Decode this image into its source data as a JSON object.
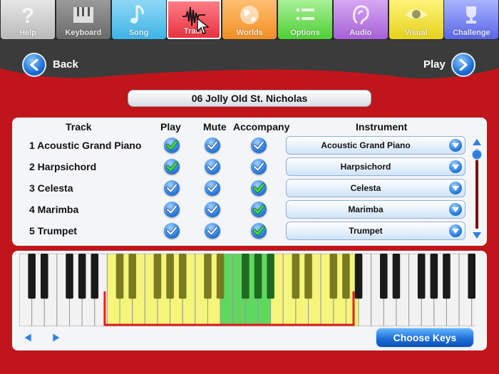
{
  "tabs": [
    {
      "label": "Help",
      "icon": "question-mark-icon",
      "color": "#e6e6e6",
      "dark": "#b9b9b9"
    },
    {
      "label": "Keyboard",
      "icon": "keyboard-icon",
      "color": "#9a9a9a",
      "dark": "#6a6a6a"
    },
    {
      "label": "Song",
      "icon": "music-note-icon",
      "color": "#8fd8f5",
      "dark": "#3fb3e6"
    },
    {
      "label": "Track",
      "icon": "waveform-icon",
      "color": "#ff7d86",
      "dark": "#e8323f",
      "active": true
    },
    {
      "label": "Worlds",
      "icon": "globe-icon",
      "color": "#ffbf73",
      "dark": "#f08f22"
    },
    {
      "label": "Options",
      "icon": "list-icon",
      "color": "#a8f096",
      "dark": "#4fcf35"
    },
    {
      "label": "Audio",
      "icon": "ear-icon",
      "color": "#d7a8f2",
      "dark": "#a560d6"
    },
    {
      "label": "Visual",
      "icon": "eye-icon",
      "color": "#fff37a",
      "dark": "#e6d21c"
    },
    {
      "label": "Challenge",
      "icon": "trophy-icon",
      "color": "#a9b4ff",
      "dark": "#5966e6"
    }
  ],
  "header": {
    "back_label": "Back",
    "play_label": "Play"
  },
  "song_title": "06 Jolly Old St. Nicholas",
  "track_columns": {
    "track": "Track",
    "play": "Play",
    "mute": "Mute",
    "accompany": "Accompany",
    "instrument": "Instrument"
  },
  "tracks": [
    {
      "name": "1 Acoustic Grand Piano",
      "play": true,
      "mute": false,
      "accompany": false,
      "instrument": "Acoustic Grand Piano"
    },
    {
      "name": "2 Harpsichord",
      "play": true,
      "mute": false,
      "accompany": false,
      "instrument": "Harpsichord"
    },
    {
      "name": "3 Celesta",
      "play": false,
      "mute": false,
      "accompany": true,
      "instrument": "Celesta"
    },
    {
      "name": "4 Marimba",
      "play": false,
      "mute": false,
      "accompany": true,
      "instrument": "Marimba"
    },
    {
      "name": "5 Trumpet",
      "play": false,
      "mute": false,
      "accompany": true,
      "instrument": "Trumpet"
    }
  ],
  "keyboard": {
    "choose_keys_label": "Choose Keys",
    "selected_color": "#f5f57a",
    "middle_color": "#5fd860",
    "range_color": "#e02020"
  },
  "colors": {
    "background": "#c0161b",
    "header": "#3b3b3b",
    "accent": "#1e6fd6",
    "check_on": "#40e040"
  }
}
